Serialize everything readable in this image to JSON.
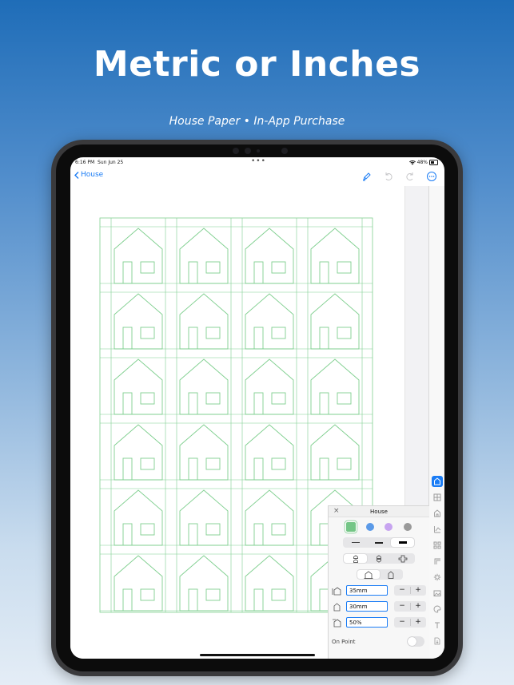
{
  "headline": "Metric or Inches",
  "subheadline": "House Paper • In-App Purchase",
  "status": {
    "time": "6:16 PM",
    "date": "Sun Jun 25",
    "battery": "48%",
    "dots": "•••"
  },
  "nav": {
    "back_label": "House",
    "icons": [
      "marker-icon",
      "undo-icon",
      "redo-icon",
      "more-icon"
    ]
  },
  "paper": {
    "rows": 6,
    "cols": 4,
    "line_color": "#7fcf8f"
  },
  "sidebar": {
    "tools": [
      "house-icon",
      "grid-icon",
      "house-outline-icon",
      "chart-icon",
      "grid-dots-icon",
      "corner-icon",
      "gear-icon",
      "image-icon",
      "palette-icon",
      "text-icon",
      "export-icon"
    ]
  },
  "panel": {
    "title": "House",
    "close": "×",
    "colors": [
      {
        "name": "green",
        "hex": "#74c686",
        "selected": true
      },
      {
        "name": "blue",
        "hex": "#5b9ae8",
        "selected": false
      },
      {
        "name": "purple",
        "hex": "#c7a4f0",
        "selected": false
      },
      {
        "name": "gray",
        "hex": "#9a9a9a",
        "selected": false
      }
    ],
    "line_weights": [
      "thin",
      "medium",
      "thick"
    ],
    "selected_weight": 2,
    "layouts": [
      "stack-icon",
      "mirror-icon",
      "cross-icon"
    ],
    "shapes": [
      "house-wide-icon",
      "house-narrow-icon"
    ],
    "fields": [
      {
        "value": "35mm",
        "minus": "−",
        "plus": "+",
        "icon": "house-width-icon"
      },
      {
        "value": "30mm",
        "minus": "−",
        "plus": "+",
        "icon": "house-height-icon"
      },
      {
        "value": "50%",
        "minus": "−",
        "plus": "+",
        "icon": "roof-pitch-icon"
      }
    ],
    "toggle_label": "On Point",
    "toggle_on": false
  },
  "colors": {
    "accent": "#1a7cf5"
  }
}
